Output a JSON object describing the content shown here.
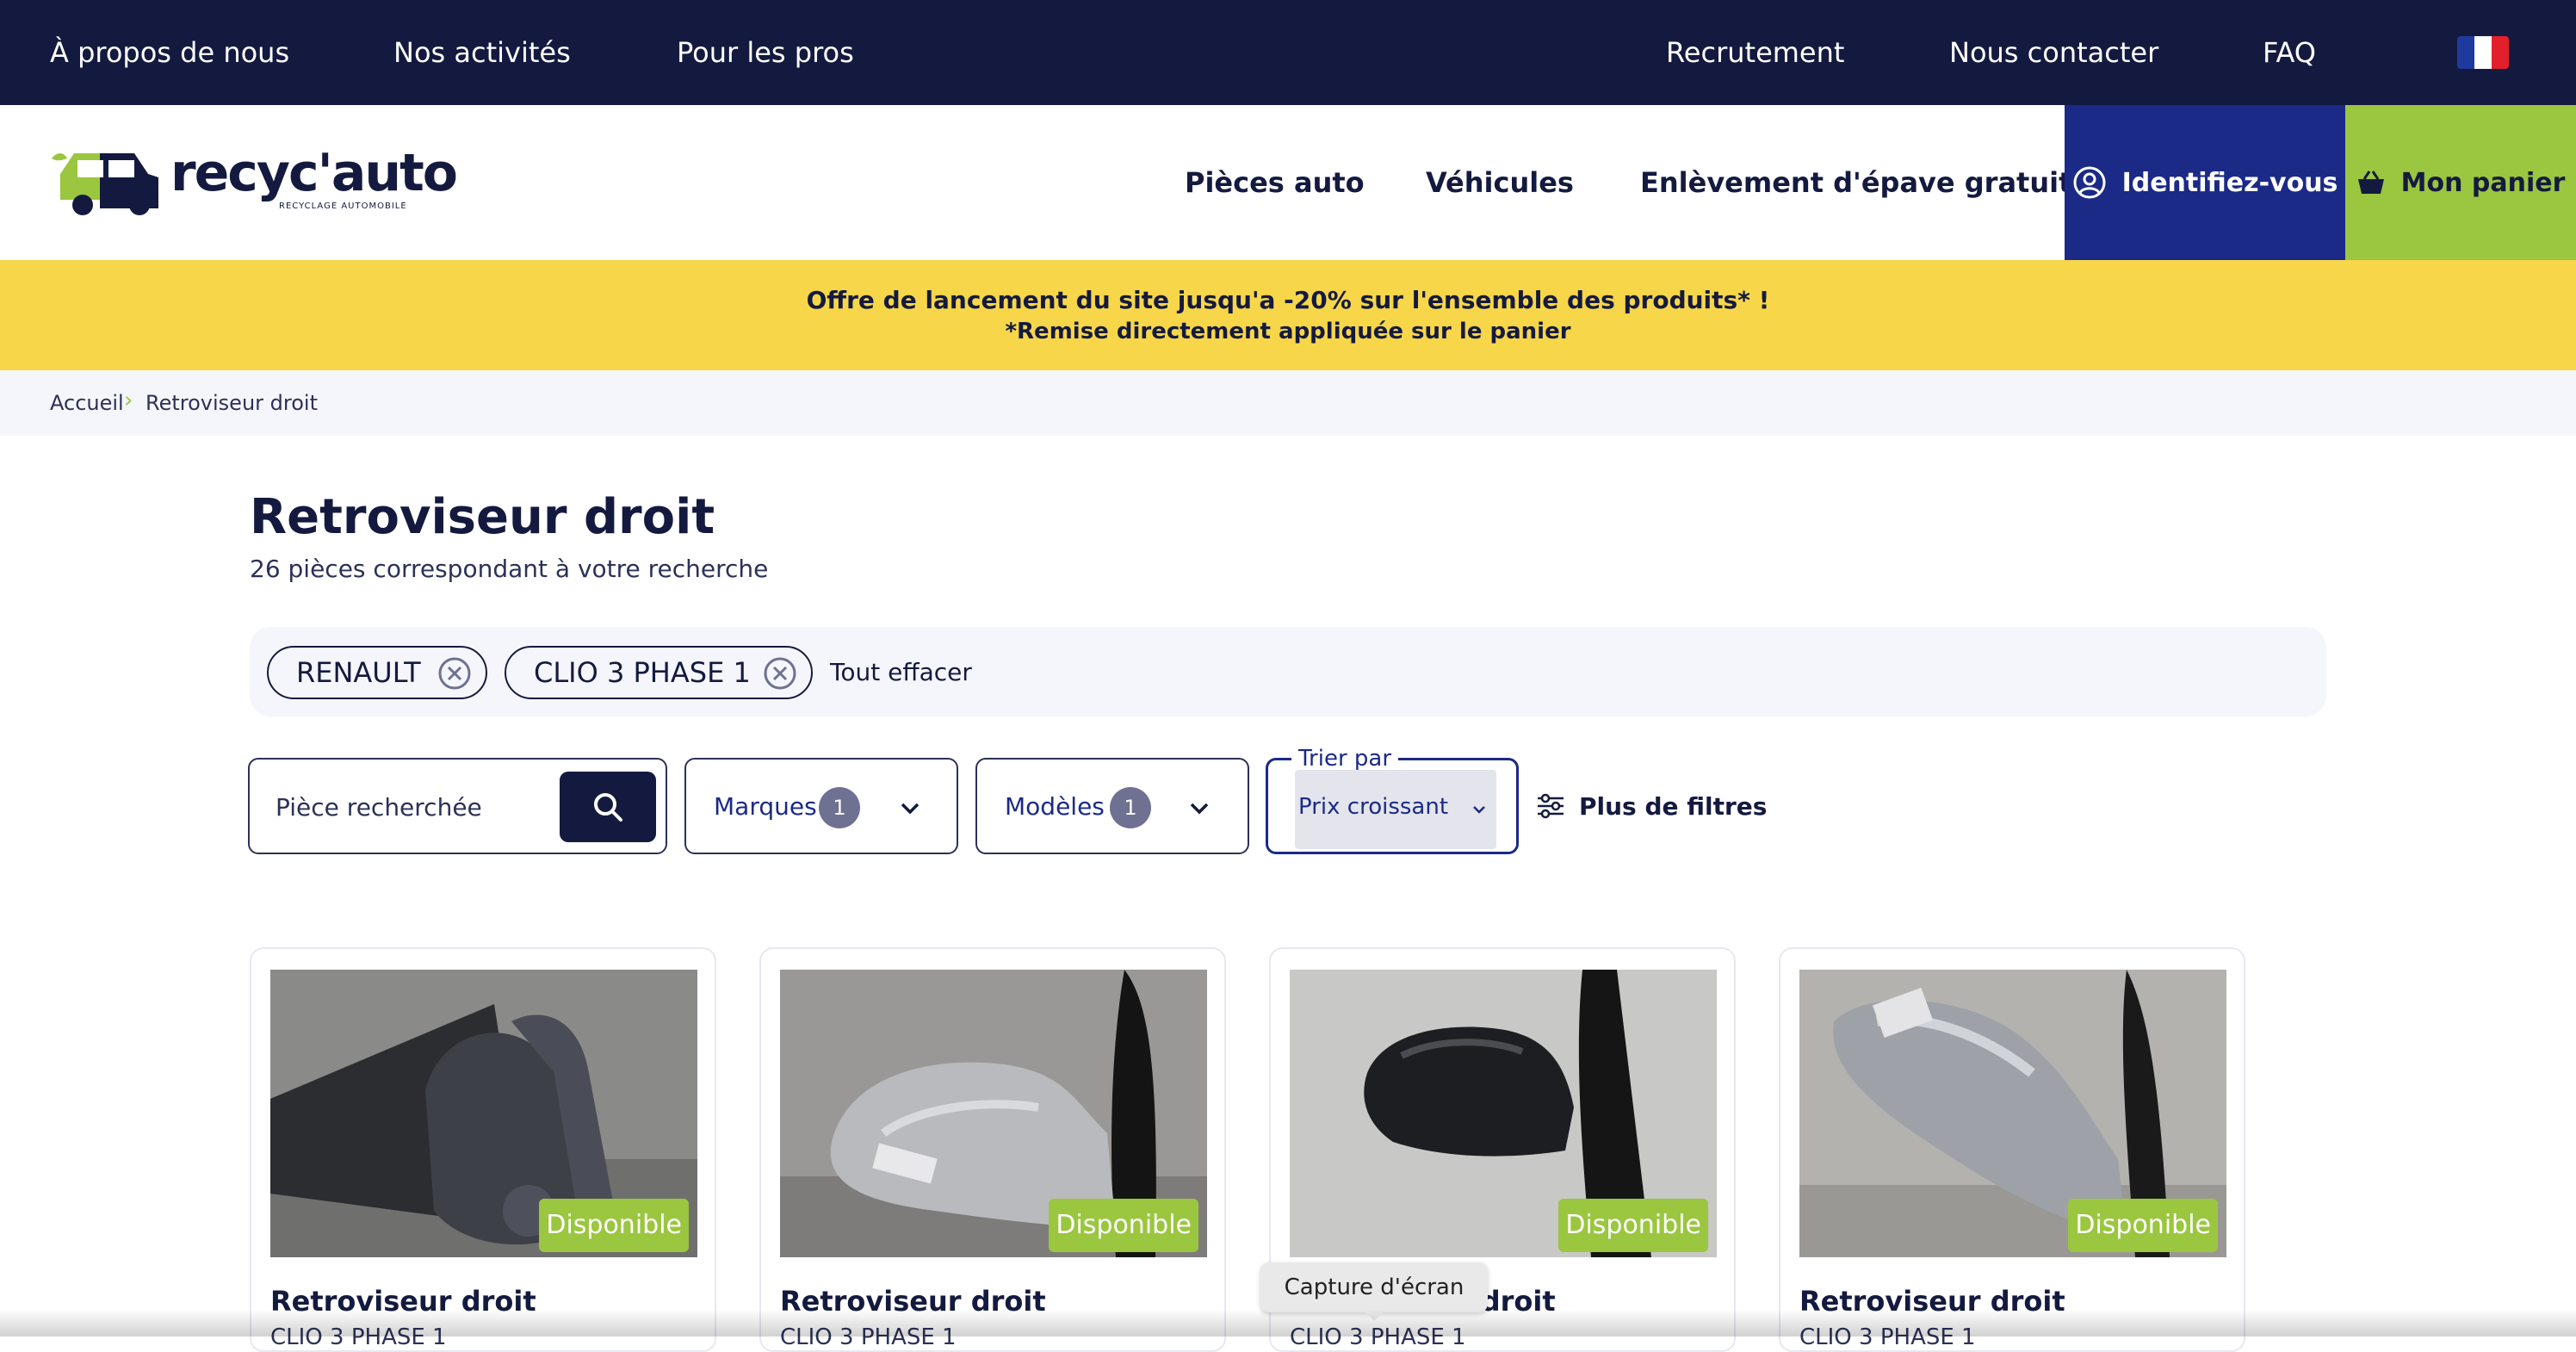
{
  "topbar": {
    "links": [
      "À propos de nous",
      "Nos activités",
      "Pour les pros",
      "Recrutement",
      "Nous contacter",
      "FAQ"
    ],
    "flag_colors": [
      "#1f3a9e",
      "#ffffff",
      "#e2202c"
    ]
  },
  "header": {
    "logo_text": "recyc'auto",
    "logo_sub": "RECYCLAGE AUTOMOBILE",
    "nav": [
      "Pièces auto",
      "Véhicules",
      "Enlèvement d'épave gratuit"
    ],
    "login_label": "Identifiez-vous",
    "cart_label": "Mon panier"
  },
  "promo": {
    "line1": "Offre de lancement du site jusqu'a -20% sur l'ensemble des produits* !",
    "line2": "*Remise directement appliquée sur le panier"
  },
  "breadcrumb": {
    "home": "Accueil",
    "current": "Retroviseur droit"
  },
  "page": {
    "title": "Retroviseur droit",
    "results": "26 pièces correspondant à votre recherche"
  },
  "active_filters": {
    "chips": [
      "RENAULT",
      "CLIO 3 PHASE 1"
    ],
    "clear_all": "Tout effacer"
  },
  "filters": {
    "search_placeholder": "Pièce recherchée",
    "brands_label": "Marques",
    "brands_count": "1",
    "models_label": "Modèles",
    "models_count": "1",
    "sort_label": "Trier par",
    "sort_value": "Prix croissant",
    "more_filters": "Plus de filtres"
  },
  "products": [
    {
      "title": "Retroviseur droit",
      "subtitle": "CLIO 3 PHASE 1",
      "status": "Disponible",
      "color": "dark-grey"
    },
    {
      "title": "Retroviseur droit",
      "subtitle": "CLIO 3 PHASE 1",
      "status": "Disponible",
      "color": "silver"
    },
    {
      "title": "Retroviseur droit",
      "subtitle": "CLIO 3 PHASE 1",
      "status": "Disponible",
      "color": "black"
    },
    {
      "title": "Retroviseur droit",
      "subtitle": "CLIO 3 PHASE 1",
      "status": "Disponible",
      "color": "silver"
    }
  ],
  "tooltip": "Capture d'écran"
}
